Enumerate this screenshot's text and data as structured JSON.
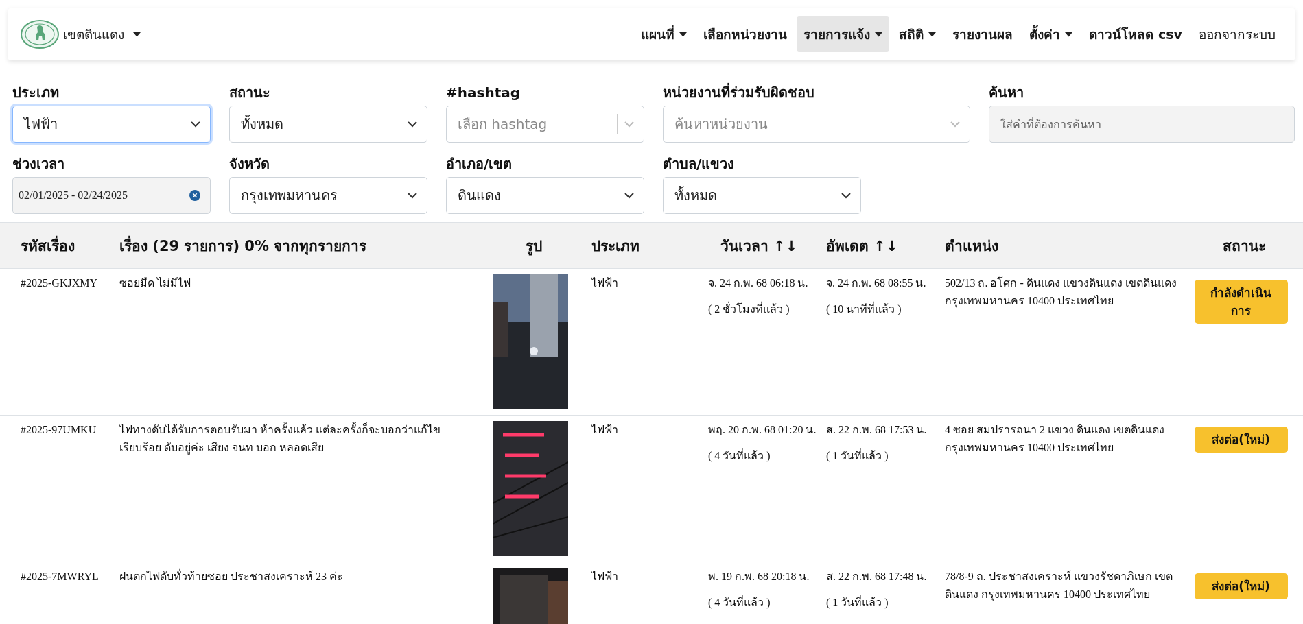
{
  "navbar": {
    "brand": {
      "label": "เขตดินแดง",
      "dropdown": true
    },
    "items": [
      {
        "label": "แผนที่",
        "dropdown": true,
        "selected": false,
        "kind": "menu"
      },
      {
        "label": "เลือกหน่วยงาน",
        "dropdown": false,
        "selected": false,
        "kind": "menu"
      },
      {
        "label": "รายการแจ้ง",
        "dropdown": true,
        "selected": true,
        "kind": "menu"
      },
      {
        "label": "สถิติ",
        "dropdown": true,
        "selected": false,
        "kind": "menu"
      },
      {
        "label": "รายงานผล",
        "dropdown": false,
        "selected": false,
        "kind": "menu"
      },
      {
        "label": "ตั้งค่า",
        "dropdown": true,
        "selected": false,
        "kind": "menu"
      },
      {
        "label": "ดาวน์โหลด csv",
        "dropdown": false,
        "selected": false,
        "kind": "menu"
      },
      {
        "label": "ออกจากระบบ",
        "dropdown": false,
        "selected": false,
        "kind": "action"
      }
    ]
  },
  "filters": [
    [
      {
        "label": "ประเภท",
        "kind": "select",
        "value": "ไฟฟ้า",
        "focused": true
      },
      {
        "label": "สถานะ",
        "kind": "select",
        "value": "ทั้งหมด",
        "focused": false
      },
      {
        "label": "#hashtag",
        "kind": "combo",
        "placeholder": "เลือก hashtag",
        "focused": false
      },
      {
        "label": "หน่วยงานที่ร่วมรับผิดชอบ",
        "kind": "combo",
        "placeholder": "ค้นหาหน่วยงาน",
        "focused": false
      },
      {
        "label": "ค้นหา",
        "kind": "text",
        "placeholder": "ใส่คำที่ต้องการค้นหา",
        "focused": false
      }
    ],
    [
      {
        "label": "ช่วงเวลา",
        "kind": "daterange",
        "value": "02/01/2025 - 02/24/2025",
        "focused": false
      },
      {
        "label": "จังหวัด",
        "kind": "select",
        "value": "กรุงเทพมหานคร",
        "focused": false
      },
      {
        "label": "อำเภอ/เขต",
        "kind": "select",
        "value": "ดินแดง",
        "focused": false
      },
      {
        "label": "ตำบล/แขวง",
        "kind": "select",
        "value": "ทั้งหมด",
        "focused": false
      }
    ]
  ],
  "table": {
    "columns": [
      {
        "label": "รหัสเรื่อง"
      },
      {
        "label": "เรื่อง (29 รายการ) 0% จากทุกรายการ"
      },
      {
        "label": "รูป"
      },
      {
        "label": "ประเภท"
      },
      {
        "label": "วันเวลา",
        "sort": "↑↓"
      },
      {
        "label": "อัพเดต",
        "sort": "↑↓"
      },
      {
        "label": "ตำแหน่ง"
      },
      {
        "label": "สถานะ"
      }
    ],
    "rows": [
      {
        "code": "#2025-GKJXMY",
        "title": "ซอยมืด ไม่มีไฟ",
        "type": "ไฟฟ้า",
        "date": "จ. 24 ก.พ. 68 06:18 น.",
        "date_ago": "( 2 ชั่วโมงที่แล้ว )",
        "updated": "จ. 24 ก.พ. 68 08:55 น.",
        "updated_ago": "( 10 นาทีที่แล้ว )",
        "location": "502/13 ถ. อโศก - ดินแดง แขวงดินแดง เขตดินแดง กรุงเทพมหานคร 10400 ประเทศไทย",
        "status": "กำลังดำเนินการ"
      },
      {
        "code": "#2025-97UMKU",
        "title": "ไฟทางดับได้รับการตอบรับมา ห้าครั้งแล้ว แต่ละครั้งก็จะบอกว่าแก้ไขเรียบร้อย ดับอยู่ค่ะ เสียง จนท บอก หลอดเสีย",
        "type": "ไฟฟ้า",
        "date": "พฤ. 20 ก.พ. 68 01:20 น.",
        "date_ago": "( 4 วันที่แล้ว )",
        "updated": "ส. 22 ก.พ. 68 17:53 น.",
        "updated_ago": "( 1 วันที่แล้ว )",
        "location": "4 ซอย สมปรารถนา 2 แขวง ดินแดง เขตดินแดง กรุงเทพมหานคร 10400 ประเทศไทย",
        "status": "ส่งต่อ(ใหม่)"
      },
      {
        "code": "#2025-7MWRYL",
        "title": "ฝนตกไฟดับทั่วท้ายซอย ประชาสงเคราะห์ 23 ค่ะ",
        "type": "ไฟฟ้า",
        "date": "พ. 19 ก.พ. 68 20:18 น.",
        "date_ago": "( 4 วันที่แล้ว )",
        "updated": "ส. 22 ก.พ. 68 17:48 น.",
        "updated_ago": "( 1 วันที่แล้ว )",
        "location": "78/8-9 ถ. ประชาสงเคราะห์ แขวงรัชดาภิเษก เขตดินแดง กรุงเทพมหานคร 10400 ประเทศไทย",
        "status": "ส่งต่อ(ใหม่)"
      }
    ]
  }
}
